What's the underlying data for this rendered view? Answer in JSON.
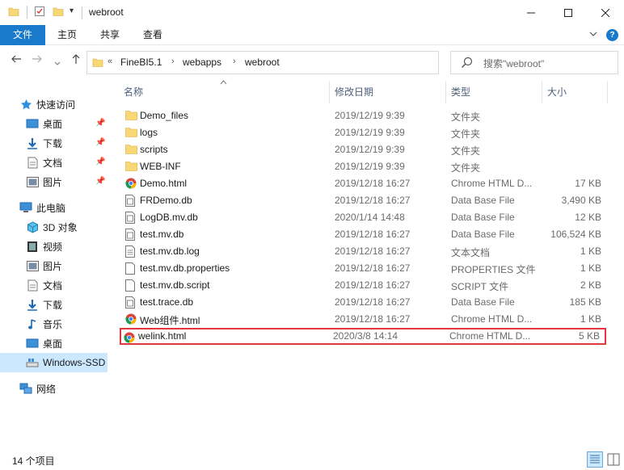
{
  "window": {
    "title": "webroot",
    "qa_dropdown": "▾"
  },
  "ribbon": {
    "tabs": [
      "文件",
      "主页",
      "共享",
      "查看"
    ]
  },
  "address": {
    "overflow": "«",
    "crumbs": [
      "FineBI5.1",
      "webapps",
      "webroot"
    ]
  },
  "search": {
    "placeholder": "搜索\"webroot\""
  },
  "sidebar": {
    "quick_access": "快速访问",
    "quick_items": [
      "桌面",
      "下载",
      "文档",
      "图片"
    ],
    "this_pc": "此电脑",
    "pc_items": [
      "3D 对象",
      "视频",
      "图片",
      "文档",
      "下载",
      "音乐",
      "桌面"
    ],
    "drive": "Windows-SSD",
    "network": "网络"
  },
  "columns": {
    "name": "名称",
    "date": "修改日期",
    "type": "类型",
    "size": "大小"
  },
  "files": [
    {
      "name": "Demo_files",
      "date": "2019/12/19 9:39",
      "type": "文件夹",
      "size": "",
      "icon": "folder-icon"
    },
    {
      "name": "logs",
      "date": "2019/12/19 9:39",
      "type": "文件夹",
      "size": "",
      "icon": "folder-icon"
    },
    {
      "name": "scripts",
      "date": "2019/12/19 9:39",
      "type": "文件夹",
      "size": "",
      "icon": "folder-icon"
    },
    {
      "name": "WEB-INF",
      "date": "2019/12/19 9:39",
      "type": "文件夹",
      "size": "",
      "icon": "folder-icon"
    },
    {
      "name": "Demo.html",
      "date": "2019/12/18 16:27",
      "type": "Chrome HTML D...",
      "size": "17 KB",
      "icon": "chrome-icon"
    },
    {
      "name": "FRDemo.db",
      "date": "2019/12/18 16:27",
      "type": "Data Base File",
      "size": "3,490 KB",
      "icon": "db-file-icon"
    },
    {
      "name": "LogDB.mv.db",
      "date": "2020/1/14 14:48",
      "type": "Data Base File",
      "size": "12 KB",
      "icon": "db-file-icon"
    },
    {
      "name": "test.mv.db",
      "date": "2019/12/18 16:27",
      "type": "Data Base File",
      "size": "106,524 KB",
      "icon": "db-file-icon"
    },
    {
      "name": "test.mv.db.log",
      "date": "2019/12/18 16:27",
      "type": "文本文档",
      "size": "1 KB",
      "icon": "text-file-icon"
    },
    {
      "name": "test.mv.db.properties",
      "date": "2019/12/18 16:27",
      "type": "PROPERTIES 文件",
      "size": "1 KB",
      "icon": "blank-file-icon"
    },
    {
      "name": "test.mv.db.script",
      "date": "2019/12/18 16:27",
      "type": "SCRIPT 文件",
      "size": "2 KB",
      "icon": "blank-file-icon"
    },
    {
      "name": "test.trace.db",
      "date": "2019/12/18 16:27",
      "type": "Data Base File",
      "size": "185 KB",
      "icon": "db-file-icon"
    },
    {
      "name": "Web组件.html",
      "date": "2019/12/18 16:27",
      "type": "Chrome HTML D...",
      "size": "1 KB",
      "icon": "chrome-icon"
    },
    {
      "name": "welink.html",
      "date": "2020/3/8 14:14",
      "type": "Chrome HTML D...",
      "size": "5 KB",
      "icon": "chrome-icon",
      "highlighted": true
    }
  ],
  "status": {
    "count": "14 个项目"
  },
  "colors": {
    "accent": "#1979ca",
    "highlight_border": "#e2373f",
    "selected_bg": "#cce8ff",
    "folder": "#f8d775"
  }
}
